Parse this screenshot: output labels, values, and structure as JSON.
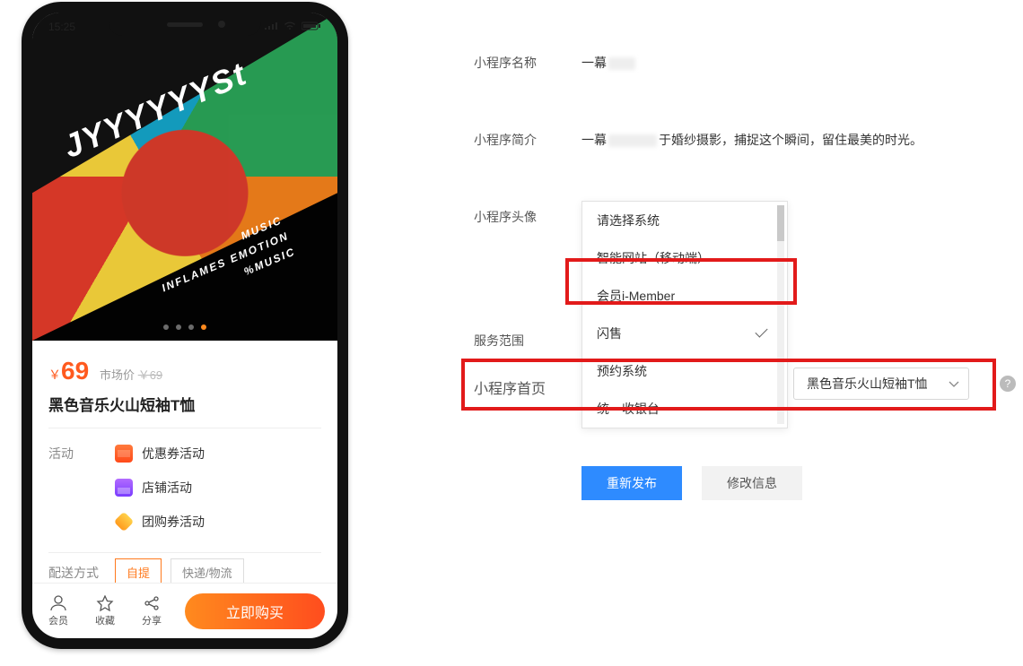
{
  "phone": {
    "statusbar": {
      "time": "15:25"
    },
    "hero": {
      "brand_text": "JYYYYYYSt",
      "tagline_l1": "MUSIC",
      "tagline_l2": "INFLAMES EMOTION",
      "tagline_l3": "%MUSIC",
      "pager_active_index": 3,
      "pager_count": 4
    },
    "product": {
      "currency": "￥",
      "price": "69",
      "market_label": "市场价",
      "market_price": "￥69",
      "title": "黑色音乐火山短袖T恤"
    },
    "activity": {
      "section_label": "活动",
      "items": [
        {
          "icon": "coupon",
          "label": "优惠券活动"
        },
        {
          "icon": "store",
          "label": "店铺活动"
        },
        {
          "icon": "diamond",
          "label": "团购券活动"
        }
      ]
    },
    "shipping": {
      "section_label": "配送方式",
      "options": [
        "自提",
        "快递/物流"
      ],
      "selected_index": 0
    },
    "bottombar": {
      "member": "会员",
      "favorite": "收藏",
      "share": "分享",
      "buy": "立即购买"
    }
  },
  "form": {
    "labels": {
      "name": "小程序名称",
      "intro": "小程序简介",
      "avatar": "小程序头像",
      "scope": "服务范围",
      "home": "小程序首页"
    },
    "name_value": "一幕",
    "intro_prefix": "一幕",
    "intro_suffix": "于婚纱摄影，捕捉这个瞬间，留住最美的时光。",
    "dropdown": {
      "items": [
        "请选择系统",
        "智能网站（移动端）",
        "会员i-Member",
        "闪售",
        "预约系统",
        "统一收银台"
      ],
      "checked_index": 3
    },
    "home_select1": "闪售",
    "home_select2": "黑色音乐火山短袖T恤",
    "buttons": {
      "publish": "重新发布",
      "edit": "修改信息"
    }
  }
}
